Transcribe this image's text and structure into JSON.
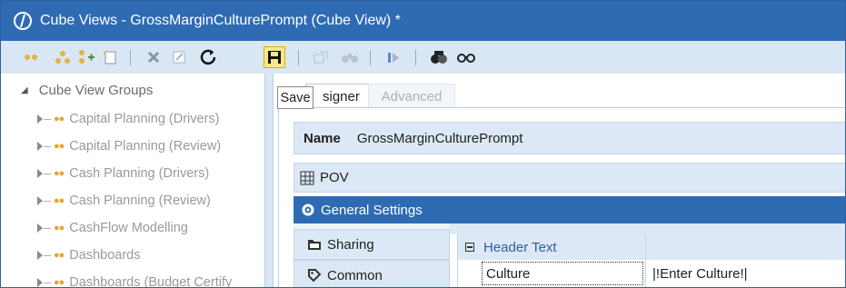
{
  "window": {
    "title": "Cube Views - GrossMarginCulturePrompt (Cube View) *"
  },
  "toolbar": {
    "icons": [
      "create-group-icon",
      "create-profile-icon",
      "add-item-icon",
      "copy-icon",
      "delete-icon",
      "rename-icon",
      "refresh-icon",
      "save-icon",
      "open-icon",
      "search-icon",
      "arrow-icon",
      "cube-icon",
      "glasses-icon"
    ],
    "save_tooltip": "Save"
  },
  "tree": {
    "root_label": "Cube View Groups",
    "items": [
      {
        "label": "Capital Planning (Drivers)"
      },
      {
        "label": "Capital Planning (Review)"
      },
      {
        "label": "Cash Planning (Drivers)"
      },
      {
        "label": "Cash Planning (Review)"
      },
      {
        "label": "CashFlow Modelling"
      },
      {
        "label": "Dashboards"
      },
      {
        "label": "Dashboards (Budget Certify"
      }
    ]
  },
  "tabs": {
    "designer_label": "signer",
    "advanced_label": "Advanced"
  },
  "form": {
    "name_label": "Name",
    "name_value": "GrossMarginCulturePrompt",
    "pov_label": "POV",
    "general_settings_label": "General Settings",
    "nav": [
      {
        "label": "Sharing",
        "icon": "folder-icon"
      },
      {
        "label": "Common",
        "icon": "tag-icon"
      }
    ],
    "grid": {
      "section_label": "Header Text",
      "rows": [
        {
          "label": "Culture",
          "value": "|!Enter Culture!|"
        }
      ]
    }
  },
  "colors": {
    "titlebar": "#2f6bb3",
    "toolbar": "#d9e7f5",
    "panel": "#dce8f5",
    "accent": "#2f6bb3"
  }
}
